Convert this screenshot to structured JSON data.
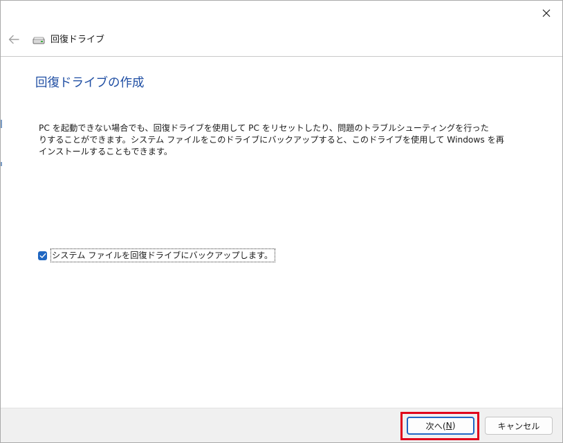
{
  "window": {
    "title": "回復ドライブ",
    "icons": {
      "close": "close-icon",
      "back": "back-arrow-icon",
      "drive": "drive-icon"
    }
  },
  "main": {
    "heading": "回復ドライブの作成",
    "description_lines": [
      "PC を起動できない場合でも、回復ドライブを使用して PC をリセットしたり、問題のトラブルシューティングを行った",
      "りすることができます。システム ファイルをこのドライブにバックアップすると、このドライブを使用して Windows を再",
      "インストールすることもできます。"
    ],
    "backup_checkbox": {
      "label": "システム ファイルを回復ドライブにバックアップします。",
      "checked": true
    }
  },
  "footer": {
    "next_button": {
      "prefix": "次へ(",
      "mnemonic": "N",
      "suffix": ")"
    },
    "cancel_button": {
      "label": "キャンセル"
    }
  },
  "colors": {
    "heading": "#1f4ea3",
    "checkbox": "#1f66c1",
    "primary_border": "#2065c4",
    "highlight": "#e0001b",
    "footer_bg": "#f0f0f0"
  }
}
